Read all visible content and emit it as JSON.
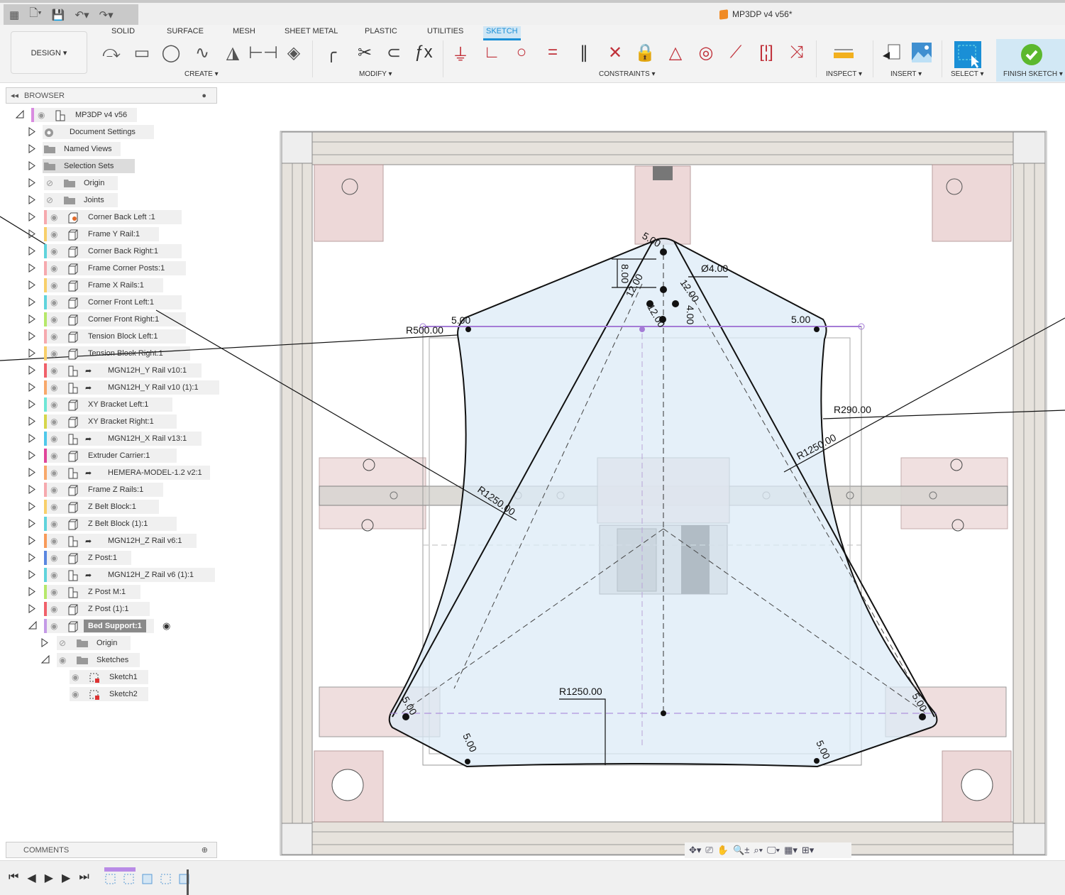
{
  "app": {
    "document_title": "MP3DP v4 v56*"
  },
  "quick_access": [
    {
      "name": "grid-menu-icon",
      "glyph": "▦"
    },
    {
      "name": "file-icon",
      "glyph": "🗋▾"
    },
    {
      "name": "save-icon",
      "glyph": "💾"
    },
    {
      "name": "undo-icon",
      "glyph": "↶▾"
    },
    {
      "name": "redo-icon",
      "glyph": "↷▾"
    }
  ],
  "workspace": {
    "label": "DESIGN ▾"
  },
  "tabs": [
    {
      "label": "SOLID"
    },
    {
      "label": "SURFACE"
    },
    {
      "label": "MESH"
    },
    {
      "label": "SHEET METAL"
    },
    {
      "label": "PLASTIC"
    },
    {
      "label": "UTILITIES"
    },
    {
      "label": "SKETCH",
      "active": true
    }
  ],
  "groups": {
    "create": "CREATE ▾",
    "modify": "MODIFY ▾",
    "constraints": "CONSTRAINTS ▾",
    "inspect": "INSPECT ▾",
    "insert": "INSERT ▾",
    "select": "SELECT ▾",
    "finish": "FINISH SKETCH ▾"
  },
  "tools": {
    "create": [
      "line-icon",
      "rectangle-icon",
      "circle-icon",
      "spline-icon",
      "triangle-mirror-icon",
      "dimension-icon",
      "project-icon"
    ],
    "modify": [
      "fillet-icon",
      "trim-icon",
      "offset-icon",
      "fx-parameters-icon"
    ],
    "constraints": [
      "fix-ground-icon",
      "coincident-perpendicular-icon",
      "tangent-icon",
      "equal-icon",
      "parallel-icon",
      "perpendicular-icon",
      "lock-icon",
      "triangle-icon",
      "concentric-icon",
      "midpoint-icon",
      "symmetry-icon",
      "curvature-icon"
    ]
  },
  "colors": {
    "accent": "#1a8fd6",
    "finish_green": "#5cb82e",
    "constraint_red": "#c0313a",
    "sketch_fill": "#dcebf7",
    "selection_purple": "#a47bd6"
  },
  "browser": {
    "title": "BROWSER",
    "items": [
      {
        "label": "MP3DP v4 v56",
        "level": 0,
        "expanded": true,
        "color": "#d98be0",
        "eye": "visible",
        "icon": "assembly"
      },
      {
        "label": "Document Settings",
        "level": 1,
        "icon": "gear"
      },
      {
        "label": "Named Views",
        "level": 1,
        "icon": "folder"
      },
      {
        "label": "Selection Sets",
        "level": 1,
        "icon": "folder",
        "highlight": true
      },
      {
        "label": "Origin",
        "level": 1,
        "icon": "folder",
        "eye": "hidden"
      },
      {
        "label": "Joints",
        "level": 1,
        "icon": "folder",
        "eye": "hidden"
      },
      {
        "label": "Corner Back Left :1",
        "level": 1,
        "color": "#f6a9ae",
        "eye": "visible",
        "icon": "component-pinned"
      },
      {
        "label": "Frame Y Rail:1",
        "level": 1,
        "color": "#f8cf6a",
        "eye": "visible",
        "icon": "component"
      },
      {
        "label": "Corner Back Right:1",
        "level": 1,
        "color": "#5fd3dc",
        "eye": "visible",
        "icon": "component"
      },
      {
        "label": "Frame Corner Posts:1",
        "level": 1,
        "color": "#f6a9ae",
        "eye": "visible",
        "icon": "component"
      },
      {
        "label": "Frame X Rails:1",
        "level": 1,
        "color": "#f8cf6a",
        "eye": "visible",
        "icon": "component"
      },
      {
        "label": "Corner Front Left:1",
        "level": 1,
        "color": "#5fd3dc",
        "eye": "visible",
        "icon": "component"
      },
      {
        "label": "Corner Front Right:1",
        "level": 1,
        "color": "#b6e86a",
        "eye": "visible",
        "icon": "component"
      },
      {
        "label": "Tension Block Left:1",
        "level": 1,
        "color": "#f6a9ae",
        "eye": "visible",
        "icon": "component"
      },
      {
        "label": "Tension Block Right:1",
        "level": 1,
        "color": "#f8cf6a",
        "eye": "visible",
        "icon": "component"
      },
      {
        "label": "MGN12H_Y Rail v10:1",
        "level": 1,
        "color": "#f0606a",
        "eye": "visible",
        "icon": "assembly",
        "link": true
      },
      {
        "label": "MGN12H_Y Rail v10 (1):1",
        "level": 1,
        "color": "#f8a86a",
        "eye": "visible",
        "icon": "assembly",
        "link": true
      },
      {
        "label": "XY Bracket Left:1",
        "level": 1,
        "color": "#6ee6d6",
        "eye": "visible",
        "icon": "component"
      },
      {
        "label": "XY Bracket Right:1",
        "level": 1,
        "color": "#d6d64a",
        "eye": "visible",
        "icon": "component"
      },
      {
        "label": "MGN12H_X Rail v13:1",
        "level": 1,
        "color": "#4fc8ea",
        "eye": "visible",
        "icon": "assembly",
        "link": true
      },
      {
        "label": "Extruder Carrier:1",
        "level": 1,
        "color": "#e0459a",
        "eye": "visible",
        "icon": "component"
      },
      {
        "label": "HEMERA-MODEL-1.2 v2:1",
        "level": 1,
        "color": "#f8a86a",
        "eye": "visible",
        "icon": "assembly",
        "link": true
      },
      {
        "label": "Frame Z Rails:1",
        "level": 1,
        "color": "#f6a9ae",
        "eye": "visible",
        "icon": "component"
      },
      {
        "label": "Z Belt Block:1",
        "level": 1,
        "color": "#f8cf6a",
        "eye": "visible",
        "icon": "component"
      },
      {
        "label": "Z Belt Block (1):1",
        "level": 1,
        "color": "#5fd3dc",
        "eye": "visible",
        "icon": "component"
      },
      {
        "label": "MGN12H_Z Rail v6:1",
        "level": 1,
        "color": "#f89a5a",
        "eye": "visible",
        "icon": "assembly",
        "link": true
      },
      {
        "label": "Z Post:1",
        "level": 1,
        "color": "#5a86e0",
        "eye": "visible",
        "icon": "component"
      },
      {
        "label": "MGN12H_Z Rail v6 (1):1",
        "level": 1,
        "color": "#5fd3dc",
        "eye": "visible",
        "icon": "assembly",
        "link": true
      },
      {
        "label": "Z Post M:1",
        "level": 1,
        "color": "#b6e86a",
        "eye": "visible",
        "icon": "assembly"
      },
      {
        "label": "Z Post (1):1",
        "level": 1,
        "color": "#f0606a",
        "eye": "visible",
        "icon": "component"
      },
      {
        "label": "Bed Support:1",
        "level": 1,
        "expanded": true,
        "color": "#c49ae6",
        "eye": "visible",
        "icon": "component",
        "active": true
      },
      {
        "label": "Origin",
        "level": 2,
        "icon": "folder",
        "eye": "hidden"
      },
      {
        "label": "Sketches",
        "level": 2,
        "expanded": true,
        "icon": "folder",
        "eye": "visible"
      },
      {
        "label": "Sketch1",
        "level": 3,
        "icon": "sketch",
        "eye": "visible",
        "leaf": true
      },
      {
        "label": "Sketch2",
        "level": 3,
        "icon": "sketch",
        "eye": "visible",
        "leaf": true
      }
    ]
  },
  "comments": {
    "title": "COMMENTS"
  },
  "timeline": {
    "controls": [
      "first-icon",
      "previous-icon",
      "play-icon",
      "next-icon",
      "last-icon"
    ],
    "features": [
      "sketch-feature-icon",
      "sketch-feature-icon",
      "extrude-feature-icon",
      "sketch-feature-icon",
      "fillet-feature-icon"
    ]
  },
  "navbar": [
    "orbit-icon",
    "look-at-icon",
    "pan-icon",
    "zoom-icon",
    "fit-icon",
    "display-settings-icon",
    "grid-icon",
    "viewports-icon"
  ],
  "dimensions": {
    "r500": "R500.00",
    "d5_tl": "5.00",
    "d5_tr": "5.00",
    "dia4": "Ø4.00",
    "d8": "8.00",
    "d12a": "12.00",
    "d12b": "12.00",
    "d12c": "12.00",
    "d4": "4.00",
    "d5_top": "5.00",
    "r290": "R290.00",
    "r1250_right": "R1250.00",
    "r1250_left": "R1250.00",
    "r1250_bottom": "R1250.00",
    "d5_bl": "5.00",
    "d5_br": "5.00",
    "d5_bll": "5.00",
    "d5_brr": "5.00"
  }
}
